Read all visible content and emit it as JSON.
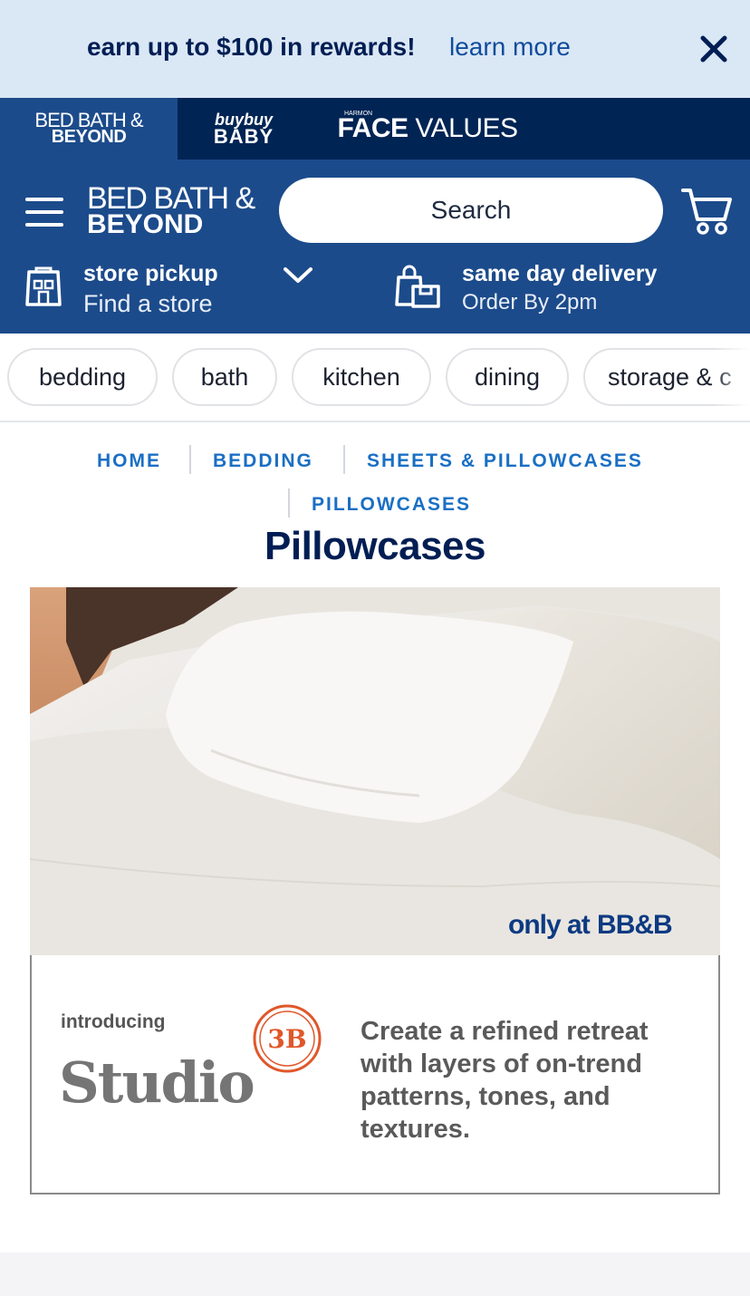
{
  "promo": {
    "text": "earn up to $100 in rewards!",
    "link": "learn more"
  },
  "brands": {
    "bbb_line1": "BED BATH &",
    "bbb_line2": "BEYOND",
    "baby_line1": "buybuy",
    "baby_line2": "BABY",
    "face_small": "HARMON",
    "face_bold": "FACE",
    "face_rest": " VALUES"
  },
  "header": {
    "logo_line1": "BED BATH &",
    "logo_line2": "BEYOND",
    "search_placeholder": "Search",
    "pickup_title": "store pickup",
    "pickup_sub": "Find a store",
    "delivery_title": "same day delivery",
    "delivery_sub": "Order By 2pm"
  },
  "categories": [
    "bedding",
    "bath",
    "kitchen",
    "dining",
    "storage & c"
  ],
  "breadcrumb": [
    "HOME",
    "BEDDING",
    "SHEETS & PILLOWCASES",
    "PILLOWCASES"
  ],
  "page_title": "Pillowcases",
  "banner": {
    "only_at": "only at",
    "only_brand": "BB&B",
    "introducing": "introducing",
    "studio": "Studio",
    "badge": "3B",
    "description": "Create a refined retreat with layers of on-trend patterns, tones, and textures."
  },
  "colors": {
    "promo_bg": "#dae7f5",
    "brand_bar": "#002454",
    "header_bg": "#1c4b8b",
    "breadcrumb": "#1a6fc4",
    "title": "#001e54",
    "badge_orange": "#e0572b"
  }
}
